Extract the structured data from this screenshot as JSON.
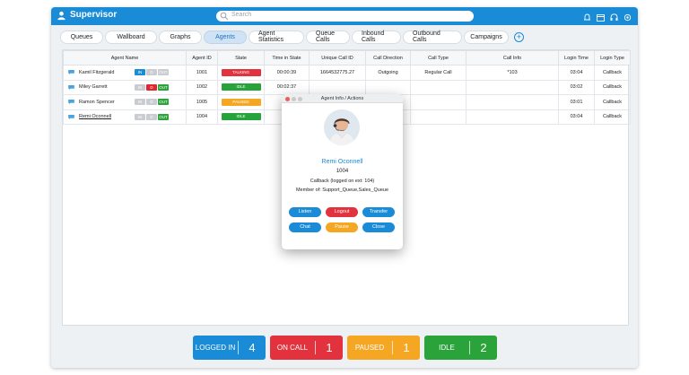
{
  "header": {
    "title": "Supervisor",
    "search_placeholder": "Search"
  },
  "tabs": [
    {
      "label": "Queues"
    },
    {
      "label": "Wallboard"
    },
    {
      "label": "Graphs"
    },
    {
      "label": "Agents",
      "active": true
    },
    {
      "label": "Agent Statistics"
    },
    {
      "label": "Queue Calls"
    },
    {
      "label": "Inbound Calls"
    },
    {
      "label": "Outbound Calls"
    },
    {
      "label": "Campaigns"
    }
  ],
  "table": {
    "columns": [
      "Agent Name",
      "Agent ID",
      "State",
      "Time in State",
      "Unique Call ID",
      "Call Direction",
      "Call Type",
      "Call Info",
      "Login Time",
      "Login Type"
    ],
    "pill_labels": {
      "in": "IN",
      "d": "D",
      "out": "OUT"
    },
    "rows": [
      {
        "name": "Kamil Fitzgerald",
        "id": "1001",
        "state": "TALKING",
        "time": "00:00:39",
        "call_id": "1664532775.27",
        "direction": "Outgoing",
        "call_type": "Regular Call",
        "call_info": "*103",
        "login_time": "03:04",
        "login_type": "Callback"
      },
      {
        "name": "Miley Garrett",
        "id": "1002",
        "state": "IDLE",
        "time": "00:02:37",
        "call_id": "",
        "direction": "",
        "call_type": "",
        "call_info": "",
        "login_time": "03:02",
        "login_type": "Callback"
      },
      {
        "name": "Ramon Spencer",
        "id": "1005",
        "state": "PAUSED",
        "time": "00:",
        "call_id": "",
        "direction": "",
        "call_type": "",
        "call_info": "",
        "login_time": "03:01",
        "login_type": "Callback"
      },
      {
        "name": "Remi Oconnell",
        "id": "1004",
        "state": "IDLE",
        "time": "00:",
        "call_id": "",
        "direction": "",
        "call_type": "",
        "call_info": "",
        "login_time": "03:04",
        "login_type": "Callback"
      }
    ]
  },
  "modal": {
    "title": "Agent Info / Actions",
    "name": "Remi Oconnell",
    "ext": "1004",
    "status": "Callback (logged on ext: 104)",
    "member": "Member of: Support_Queue,Sales_Queue",
    "buttons": {
      "listen": "Listen",
      "logout": "Logout",
      "transfer": "Transfer",
      "chat": "Chat",
      "pause": "Pause",
      "close": "Close"
    }
  },
  "summary": [
    {
      "label": "LOGGED IN",
      "value": "4"
    },
    {
      "label": "ON CALL",
      "value": "1"
    },
    {
      "label": "PAUSED",
      "value": "1"
    },
    {
      "label": "IDLE",
      "value": "2"
    }
  ],
  "colors": {
    "primary": "#1a8bd6",
    "red": "#e2323d",
    "orange": "#f5a623",
    "green": "#2aa33b"
  }
}
